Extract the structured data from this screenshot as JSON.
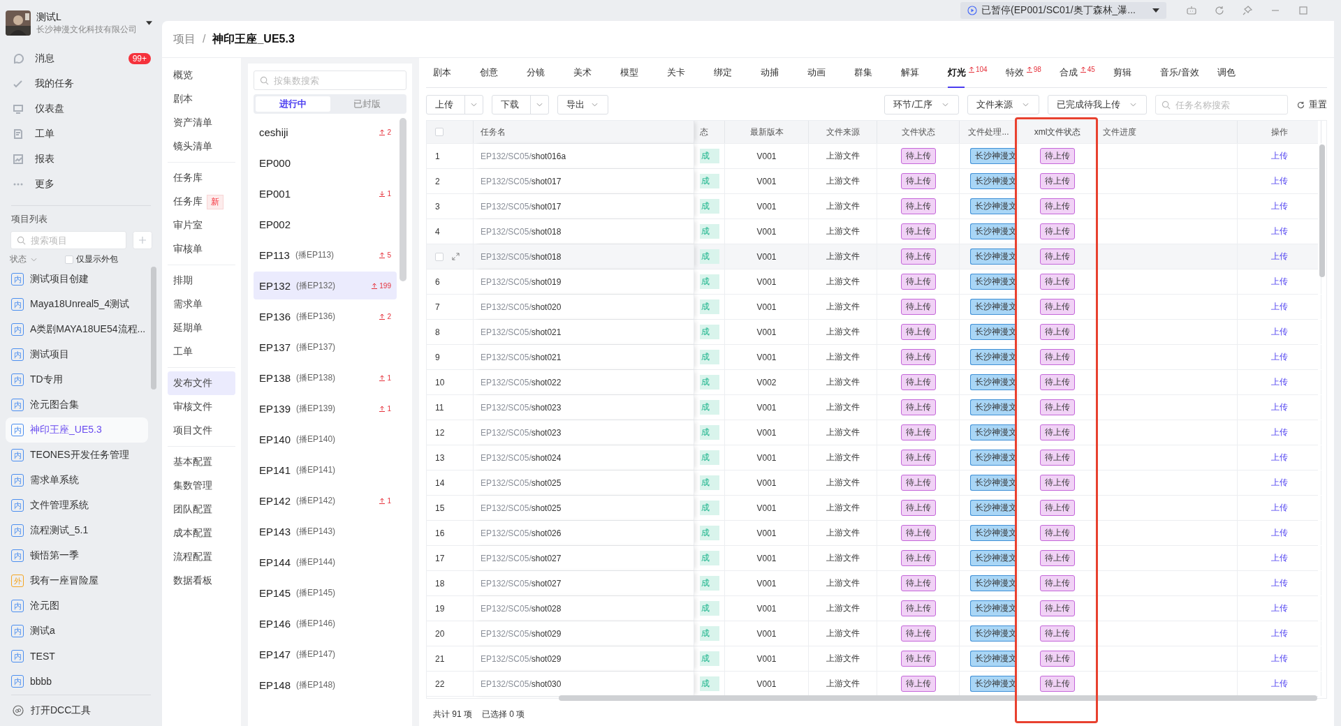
{
  "title_bar": {
    "status": "已暂停(EP001/SC01/奥丁森林_瀑..."
  },
  "user": {
    "name": "测试L",
    "company": "长沙神漫文化科技有限公司"
  },
  "nav": [
    {
      "label": "消息",
      "badge": "99+"
    },
    {
      "label": "我的任务"
    },
    {
      "label": "仪表盘"
    },
    {
      "label": "工单"
    },
    {
      "label": "报表"
    },
    {
      "label": "更多"
    }
  ],
  "projects": {
    "title": "项目列表",
    "search_placeholder": "搜索项目",
    "status_filter": "状态",
    "outsource_only": {
      "label": "仅显示外包",
      "checked": false
    },
    "items": [
      {
        "tag": "内",
        "kind": "internal",
        "name": "测试项目创建",
        "selected": false
      },
      {
        "tag": "内",
        "kind": "internal",
        "name": "Maya18Unreal5_4测试",
        "selected": false
      },
      {
        "tag": "内",
        "kind": "internal",
        "name": "A类剧MAYA18UE54流程...",
        "selected": false
      },
      {
        "tag": "内",
        "kind": "internal",
        "name": "测试项目",
        "selected": false
      },
      {
        "tag": "内",
        "kind": "internal",
        "name": "TD专用",
        "selected": false
      },
      {
        "tag": "内",
        "kind": "internal",
        "name": "沧元图合集",
        "selected": false
      },
      {
        "tag": "内",
        "kind": "internal",
        "name": "神印王座_UE5.3",
        "selected": true
      },
      {
        "tag": "内",
        "kind": "internal",
        "name": "TEONES开发任务管理",
        "selected": false
      },
      {
        "tag": "内",
        "kind": "internal",
        "name": "需求单系统",
        "selected": false
      },
      {
        "tag": "内",
        "kind": "internal",
        "name": "文件管理系统",
        "selected": false
      },
      {
        "tag": "内",
        "kind": "internal",
        "name": "流程测试_5.1",
        "selected": false
      },
      {
        "tag": "内",
        "kind": "internal",
        "name": "顿悟第一季",
        "selected": false
      },
      {
        "tag": "外",
        "kind": "external",
        "name": "我有一座冒险屋",
        "selected": false
      },
      {
        "tag": "内",
        "kind": "internal",
        "name": "沧元图",
        "selected": false
      },
      {
        "tag": "内",
        "kind": "internal",
        "name": "测试a",
        "selected": false
      },
      {
        "tag": "内",
        "kind": "internal",
        "name": "TEST",
        "selected": false
      },
      {
        "tag": "内",
        "kind": "internal",
        "name": "bbbb",
        "selected": false
      }
    ]
  },
  "dcc": "打开DCC工具",
  "breadcrumb": {
    "items": [
      "项目",
      "神印王座_UE5.3"
    ],
    "separator": "/"
  },
  "project_menu": [
    [
      {
        "label": "概览",
        "selected": false
      },
      {
        "label": "剧本",
        "selected": false
      },
      {
        "label": "资产清单",
        "selected": false
      },
      {
        "label": "镜头清单",
        "selected": false
      }
    ],
    [
      {
        "label": "任务库",
        "selected": false
      },
      {
        "label": "任务库",
        "badge": "新",
        "selected": false
      },
      {
        "label": "审片室",
        "selected": false
      },
      {
        "label": "审核单",
        "selected": false
      }
    ],
    [
      {
        "label": "排期",
        "selected": false
      },
      {
        "label": "需求单",
        "selected": false
      },
      {
        "label": "延期单",
        "selected": false
      },
      {
        "label": "工单",
        "selected": false
      }
    ],
    [
      {
        "label": "发布文件",
        "selected": true
      },
      {
        "label": "审核文件",
        "selected": false
      },
      {
        "label": "项目文件",
        "selected": false
      }
    ],
    [
      {
        "label": "基本配置",
        "selected": false
      },
      {
        "label": "集数管理",
        "selected": false
      },
      {
        "label": "团队配置",
        "selected": false
      },
      {
        "label": "成本配置",
        "selected": false
      },
      {
        "label": "流程配置",
        "selected": false
      },
      {
        "label": "数据看板",
        "selected": false
      }
    ]
  ],
  "episodes": {
    "search_placeholder": "按集数搜索",
    "tabs": [
      {
        "label": "进行中",
        "selected": true
      },
      {
        "label": "已封版",
        "selected": false
      }
    ],
    "items": [
      {
        "name": "ceshiji",
        "badge": {
          "kind": "up",
          "count": "2"
        },
        "selected": false
      },
      {
        "name": "EP000",
        "selected": false
      },
      {
        "name": "EP001",
        "badge": {
          "kind": "down",
          "count": "1"
        },
        "selected": false
      },
      {
        "name": "EP002",
        "selected": false
      },
      {
        "name": "EP113",
        "alias": "(播EP113)",
        "badge": {
          "kind": "up",
          "count": "5"
        },
        "selected": false
      },
      {
        "name": "EP132",
        "alias": "(播EP132)",
        "badge": {
          "kind": "up",
          "count": "199"
        },
        "selected": true
      },
      {
        "name": "EP136",
        "alias": "(播EP136)",
        "badge": {
          "kind": "up",
          "count": "2"
        },
        "selected": false
      },
      {
        "name": "EP137",
        "alias": "(播EP137)",
        "selected": false
      },
      {
        "name": "EP138",
        "alias": "(播EP138)",
        "badge": {
          "kind": "up",
          "count": "1"
        },
        "selected": false
      },
      {
        "name": "EP139",
        "alias": "(播EP139)",
        "badge": {
          "kind": "up",
          "count": "1"
        },
        "selected": false
      },
      {
        "name": "EP140",
        "alias": "(播EP140)",
        "selected": false
      },
      {
        "name": "EP141",
        "alias": "(播EP141)",
        "selected": false
      },
      {
        "name": "EP142",
        "alias": "(播EP142)",
        "badge": {
          "kind": "up",
          "count": "1"
        },
        "selected": false
      },
      {
        "name": "EP143",
        "alias": "(播EP143)",
        "selected": false
      },
      {
        "name": "EP144",
        "alias": "(播EP144)",
        "selected": false
      },
      {
        "name": "EP145",
        "alias": "(播EP145)",
        "selected": false
      },
      {
        "name": "EP146",
        "alias": "(播EP146)",
        "selected": false
      },
      {
        "name": "EP147",
        "alias": "(播EP147)",
        "selected": false
      },
      {
        "name": "EP148",
        "alias": "(播EP148)",
        "selected": false
      }
    ]
  },
  "tabs": [
    {
      "label": "剧本",
      "selected": false
    },
    {
      "label": "创意",
      "selected": false
    },
    {
      "label": "分镜",
      "selected": false
    },
    {
      "label": "美术",
      "selected": false
    },
    {
      "label": "模型",
      "selected": false
    },
    {
      "label": "关卡",
      "selected": false
    },
    {
      "label": "绑定",
      "selected": false
    },
    {
      "label": "动捕",
      "selected": false
    },
    {
      "label": "动画",
      "selected": false
    },
    {
      "label": "群集",
      "selected": false
    },
    {
      "label": "解算",
      "selected": false
    },
    {
      "label": "灯光",
      "selected": true,
      "badge": {
        "kind": "up",
        "count": "104"
      }
    },
    {
      "label": "特效",
      "selected": false,
      "badge": {
        "kind": "up",
        "count": "98"
      }
    },
    {
      "label": "合成",
      "selected": false,
      "badge": {
        "kind": "up",
        "count": "45"
      }
    },
    {
      "label": "剪辑",
      "selected": false
    },
    {
      "label": "音乐/音效",
      "selected": false
    },
    {
      "label": "调色",
      "selected": false
    }
  ],
  "toolbar": {
    "actions": [
      {
        "label": "上传",
        "split": true
      },
      {
        "label": "下载",
        "split": true
      },
      {
        "label": "导出",
        "split": false
      }
    ],
    "filters": [
      "环节/工序",
      "文件来源",
      "已完成待我上传"
    ],
    "search_placeholder": "任务名称搜索",
    "reset": "重置"
  },
  "table": {
    "select_all": {
      "checked": false
    },
    "columns": [
      {
        "label": "任务名",
        "highlighted": false
      },
      {
        "label": "态",
        "highlighted": false
      },
      {
        "label": "最新版本",
        "highlighted": false
      },
      {
        "label": "文件来源",
        "highlighted": false
      },
      {
        "label": "文件状态",
        "highlighted": false
      },
      {
        "label": "文件处理...",
        "highlighted": false
      },
      {
        "label": "xml文件状态",
        "highlighted": true
      },
      {
        "label": "文件进度",
        "highlighted": false
      },
      {
        "label": "操作",
        "highlighted": false
      }
    ],
    "rows": [
      {
        "index": "1",
        "path": "EP132/SC05/",
        "shot": "shot016a",
        "column_2": "成",
        "version": "V001",
        "source": "上游文件",
        "file_status": "待上传",
        "processing": "长沙神漫文",
        "xml_status": "待上传",
        "action": "上传",
        "hovered": false
      },
      {
        "index": "2",
        "path": "EP132/SC05/",
        "shot": "shot017",
        "column_2": "成",
        "version": "V001",
        "source": "上游文件",
        "file_status": "待上传",
        "processing": "长沙神漫文",
        "xml_status": "待上传",
        "action": "上传",
        "hovered": false
      },
      {
        "index": "3",
        "path": "EP132/SC05/",
        "shot": "shot017",
        "column_2": "成",
        "version": "V001",
        "source": "上游文件",
        "file_status": "待上传",
        "processing": "长沙神漫文",
        "xml_status": "待上传",
        "action": "上传",
        "hovered": false
      },
      {
        "index": "4",
        "path": "EP132/SC05/",
        "shot": "shot018",
        "column_2": "成",
        "version": "V001",
        "source": "上游文件",
        "file_status": "待上传",
        "processing": "长沙神漫文",
        "xml_status": "待上传",
        "action": "上传",
        "hovered": false
      },
      {
        "path": "EP132/SC05/",
        "shot": "shot018",
        "column_2": "成",
        "version": "V001",
        "source": "上游文件",
        "file_status": "待上传",
        "processing": "长沙神漫文",
        "xml_status": "待上传",
        "action": "上传",
        "hovered": true
      },
      {
        "index": "6",
        "path": "EP132/SC05/",
        "shot": "shot019",
        "column_2": "成",
        "version": "V001",
        "source": "上游文件",
        "file_status": "待上传",
        "processing": "长沙神漫文",
        "xml_status": "待上传",
        "action": "上传",
        "hovered": false
      },
      {
        "index": "7",
        "path": "EP132/SC05/",
        "shot": "shot020",
        "column_2": "成",
        "version": "V001",
        "source": "上游文件",
        "file_status": "待上传",
        "processing": "长沙神漫文",
        "xml_status": "待上传",
        "action": "上传",
        "hovered": false
      },
      {
        "index": "8",
        "path": "EP132/SC05/",
        "shot": "shot021",
        "column_2": "成",
        "version": "V001",
        "source": "上游文件",
        "file_status": "待上传",
        "processing": "长沙神漫文",
        "xml_status": "待上传",
        "action": "上传",
        "hovered": false
      },
      {
        "index": "9",
        "path": "EP132/SC05/",
        "shot": "shot021",
        "column_2": "成",
        "version": "V001",
        "source": "上游文件",
        "file_status": "待上传",
        "processing": "长沙神漫文",
        "xml_status": "待上传",
        "action": "上传",
        "hovered": false
      },
      {
        "index": "10",
        "path": "EP132/SC05/",
        "shot": "shot022",
        "column_2": "成",
        "version": "V002",
        "source": "上游文件",
        "file_status": "待上传",
        "processing": "长沙神漫文",
        "xml_status": "待上传",
        "action": "上传",
        "hovered": false
      },
      {
        "index": "11",
        "path": "EP132/SC05/",
        "shot": "shot023",
        "column_2": "成",
        "version": "V001",
        "source": "上游文件",
        "file_status": "待上传",
        "processing": "长沙神漫文",
        "xml_status": "待上传",
        "action": "上传",
        "hovered": false
      },
      {
        "index": "12",
        "path": "EP132/SC05/",
        "shot": "shot023",
        "column_2": "成",
        "version": "V001",
        "source": "上游文件",
        "file_status": "待上传",
        "processing": "长沙神漫文",
        "xml_status": "待上传",
        "action": "上传",
        "hovered": false
      },
      {
        "index": "13",
        "path": "EP132/SC05/",
        "shot": "shot024",
        "column_2": "成",
        "version": "V001",
        "source": "上游文件",
        "file_status": "待上传",
        "processing": "长沙神漫文",
        "xml_status": "待上传",
        "action": "上传",
        "hovered": false
      },
      {
        "index": "14",
        "path": "EP132/SC05/",
        "shot": "shot025",
        "column_2": "成",
        "version": "V001",
        "source": "上游文件",
        "file_status": "待上传",
        "processing": "长沙神漫文",
        "xml_status": "待上传",
        "action": "上传",
        "hovered": false
      },
      {
        "index": "15",
        "path": "EP132/SC05/",
        "shot": "shot025",
        "column_2": "成",
        "version": "V001",
        "source": "上游文件",
        "file_status": "待上传",
        "processing": "长沙神漫文",
        "xml_status": "待上传",
        "action": "上传",
        "hovered": false
      },
      {
        "index": "16",
        "path": "EP132/SC05/",
        "shot": "shot026",
        "column_2": "成",
        "version": "V001",
        "source": "上游文件",
        "file_status": "待上传",
        "processing": "长沙神漫文",
        "xml_status": "待上传",
        "action": "上传",
        "hovered": false
      },
      {
        "index": "17",
        "path": "EP132/SC05/",
        "shot": "shot027",
        "column_2": "成",
        "version": "V001",
        "source": "上游文件",
        "file_status": "待上传",
        "processing": "长沙神漫文",
        "xml_status": "待上传",
        "action": "上传",
        "hovered": false
      },
      {
        "index": "18",
        "path": "EP132/SC05/",
        "shot": "shot027",
        "column_2": "成",
        "version": "V001",
        "source": "上游文件",
        "file_status": "待上传",
        "processing": "长沙神漫文",
        "xml_status": "待上传",
        "action": "上传",
        "hovered": false
      },
      {
        "index": "19",
        "path": "EP132/SC05/",
        "shot": "shot028",
        "column_2": "成",
        "version": "V001",
        "source": "上游文件",
        "file_status": "待上传",
        "processing": "长沙神漫文",
        "xml_status": "待上传",
        "action": "上传",
        "hovered": false
      },
      {
        "index": "20",
        "path": "EP132/SC05/",
        "shot": "shot029",
        "column_2": "成",
        "version": "V001",
        "source": "上游文件",
        "file_status": "待上传",
        "processing": "长沙神漫文",
        "xml_status": "待上传",
        "action": "上传",
        "hovered": false
      },
      {
        "index": "21",
        "path": "EP132/SC05/",
        "shot": "shot029",
        "column_2": "成",
        "version": "V001",
        "source": "上游文件",
        "file_status": "待上传",
        "processing": "长沙神漫文",
        "xml_status": "待上传",
        "action": "上传",
        "hovered": false
      },
      {
        "index": "22",
        "path": "EP132/SC05/",
        "shot": "shot030",
        "column_2": "成",
        "version": "V001",
        "source": "上游文件",
        "file_status": "待上传",
        "processing": "长沙神漫文",
        "xml_status": "待上传",
        "action": "上传",
        "hovered": false
      }
    ]
  },
  "footer": {
    "total": "共计 91 项",
    "selected": "已选择 0 项"
  }
}
